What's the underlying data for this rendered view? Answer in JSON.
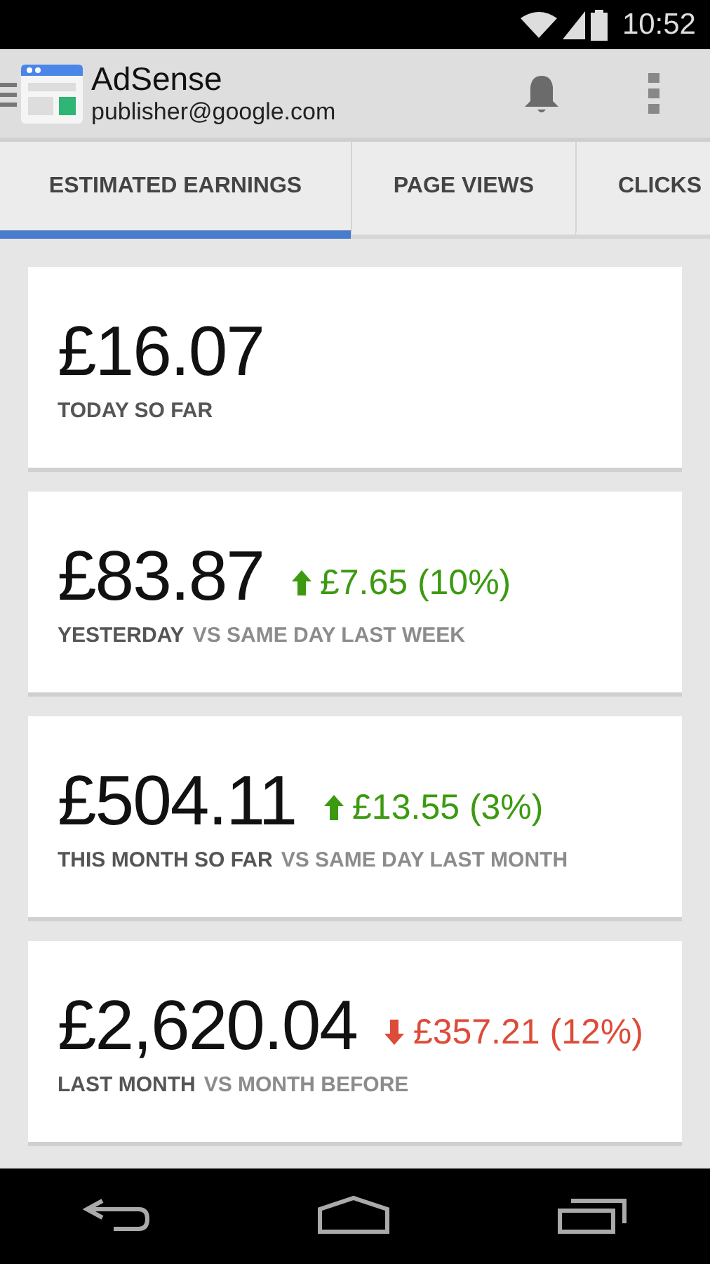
{
  "status_bar": {
    "time": "10:52"
  },
  "app_bar": {
    "title": "AdSense",
    "account": "publisher@google.com"
  },
  "tabs": [
    {
      "label": "ESTIMATED EARNINGS",
      "selected": true
    },
    {
      "label": "PAGE VIEWS",
      "selected": false
    },
    {
      "label": "CLICKS",
      "selected": false
    }
  ],
  "cards": [
    {
      "amount": "£16.07",
      "period": "TODAY SO FAR"
    },
    {
      "amount": "£83.87",
      "change": {
        "kind": "up",
        "text": "£7.65 (10%)"
      },
      "period": "YESTERDAY",
      "comparison": "VS SAME DAY LAST WEEK"
    },
    {
      "amount": "£504.11",
      "change": {
        "kind": "up",
        "text": "£13.55 (3%)"
      },
      "period": "THIS MONTH SO FAR",
      "comparison": "VS SAME DAY LAST MONTH"
    },
    {
      "amount": "£2,620.04",
      "change": {
        "kind": "down",
        "text": "£357.21 (12%)"
      },
      "period": "LAST MONTH",
      "comparison": "VS MONTH BEFORE"
    }
  ]
}
